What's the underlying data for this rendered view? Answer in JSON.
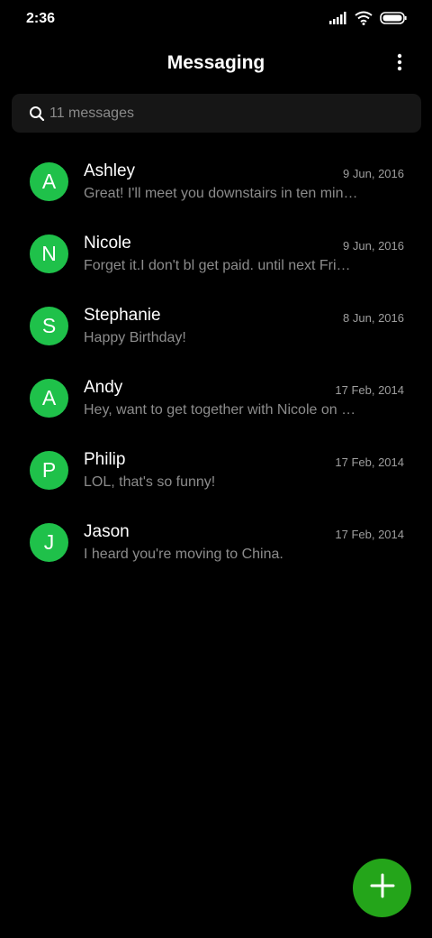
{
  "status_bar": {
    "time": "2:36",
    "icons": [
      "signal-icon",
      "wifi-icon",
      "battery-icon"
    ]
  },
  "header": {
    "title": "Messaging",
    "menu_icon": "more-vertical-icon"
  },
  "search": {
    "placeholder": "11 messages",
    "icon": "search-icon"
  },
  "conversations": [
    {
      "initial": "A",
      "name": "Ashley",
      "date": "9 Jun, 2016",
      "snippet": "Great! I'll meet you downstairs in ten min…"
    },
    {
      "initial": "N",
      "name": "Nicole",
      "date": "9 Jun, 2016",
      "snippet": "Forget it.I don't bl get paid. until next Frid…"
    },
    {
      "initial": "S",
      "name": "Stephanie",
      "date": "8 Jun, 2016",
      "snippet": "Happy Birthday!"
    },
    {
      "initial": "A",
      "name": "Andy",
      "date": "17 Feb, 2014",
      "snippet": "Hey, want to get together with Nicole on F…"
    },
    {
      "initial": "P",
      "name": "Philip",
      "date": "17 Feb, 2014",
      "snippet": "LOL, that's so funny!"
    },
    {
      "initial": "J",
      "name": "Jason",
      "date": "17 Feb, 2014",
      "snippet": "I heard you're moving to China."
    }
  ],
  "fab": {
    "icon": "plus-icon"
  },
  "colors": {
    "background": "#000000",
    "avatar": "#1fc14a",
    "fab": "#24a51a",
    "search_bg": "#161616",
    "secondary_text": "#8c8c8c"
  }
}
